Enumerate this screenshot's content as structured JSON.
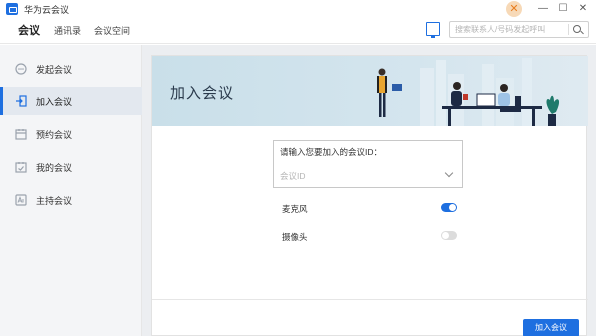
{
  "app": {
    "title": "华为云会议"
  },
  "window": {
    "minimize": "—",
    "maximize": "☐",
    "close": "✕",
    "brand": "✕"
  },
  "nav": {
    "tabs": [
      {
        "label": "会议"
      },
      {
        "label": "通讯录"
      },
      {
        "label": "会议空间"
      }
    ],
    "search_placeholder": "搜索联系人/号码发起呼叫"
  },
  "sidebar": {
    "items": [
      {
        "label": "发起会议",
        "icon": "chat-icon"
      },
      {
        "label": "加入会议",
        "icon": "join-icon"
      },
      {
        "label": "预约会议",
        "icon": "calendar-icon"
      },
      {
        "label": "我的会议",
        "icon": "my-meeting-icon"
      },
      {
        "label": "主持会议",
        "icon": "host-icon"
      }
    ]
  },
  "main": {
    "banner_title": "加入会议",
    "meeting_id_label": "请输入您要加入的会议ID：",
    "meeting_id_placeholder": "会议ID",
    "microphone_label": "麦克风",
    "microphone_on": true,
    "camera_label": "摄像头",
    "camera_on": false,
    "join_button": "加入会议"
  },
  "colors": {
    "accent": "#1e6fe0",
    "banner": "#cfe2ec",
    "sidebar_bg": "#f4f5f7"
  }
}
